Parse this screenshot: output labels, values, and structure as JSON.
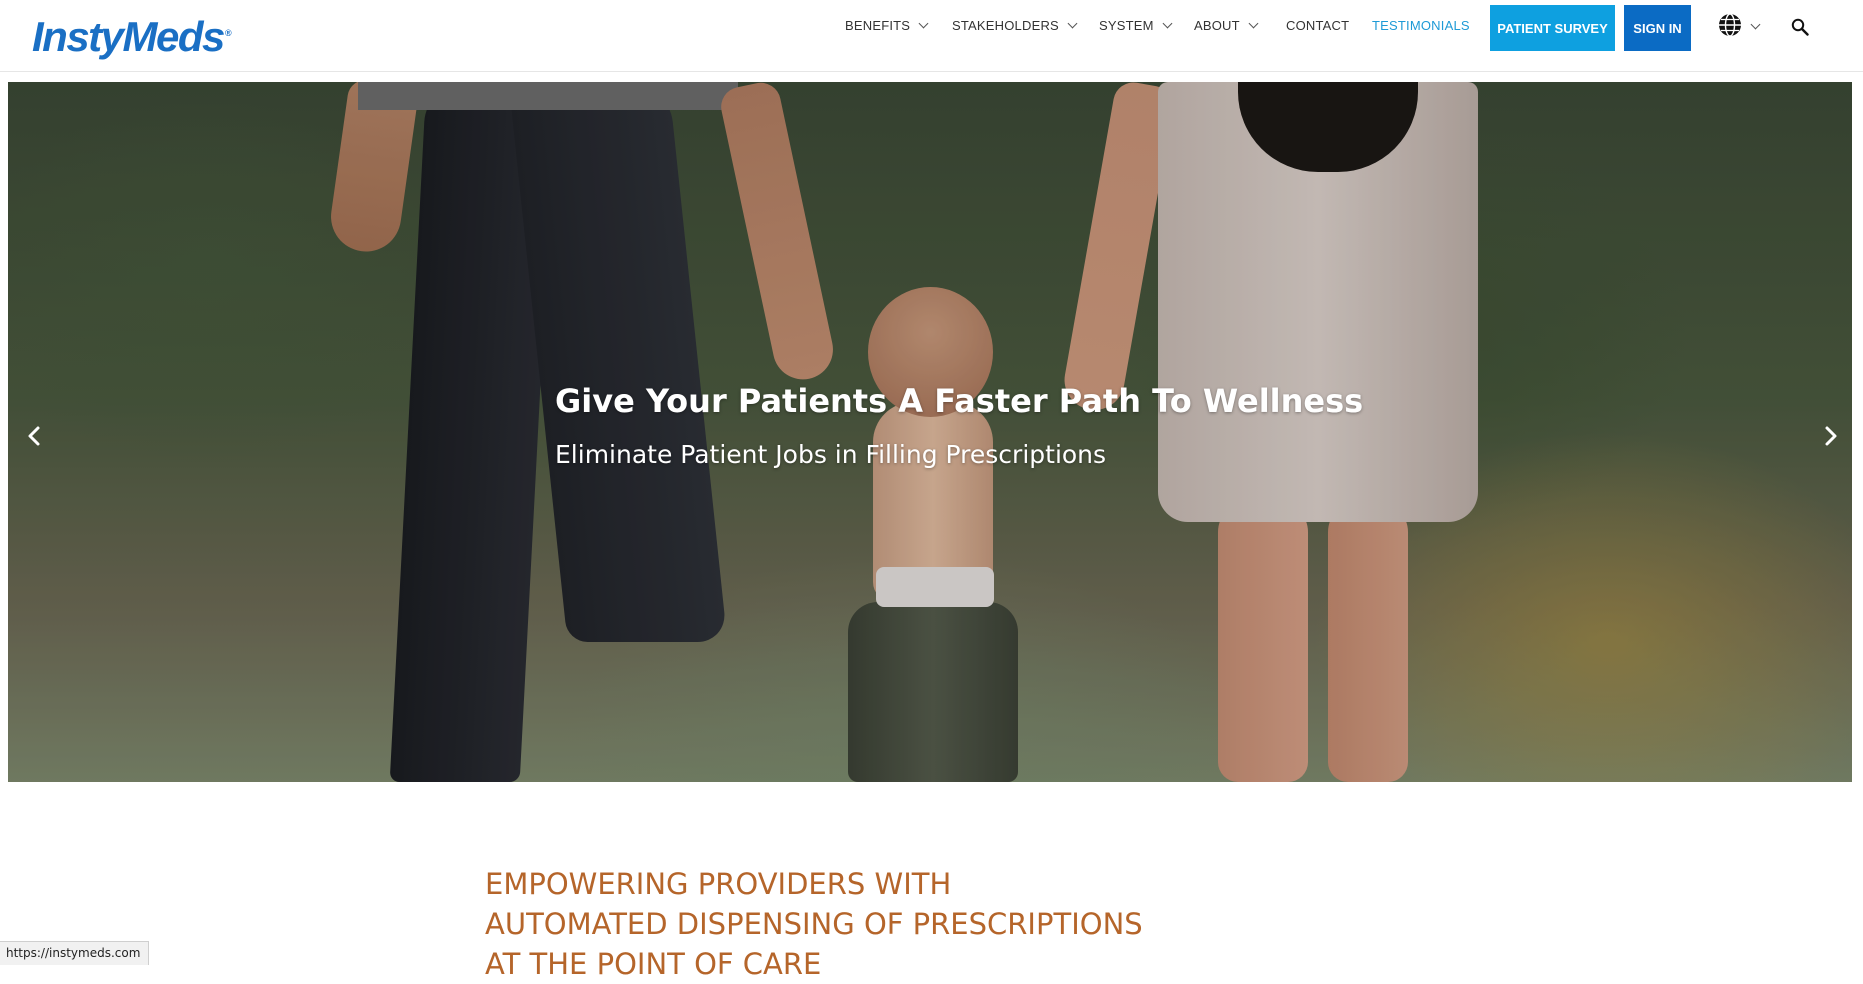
{
  "brand": {
    "name": "InstyMeds",
    "color": "#1a6fc4"
  },
  "nav": {
    "items": [
      {
        "label": "BENEFITS",
        "has_dropdown": true
      },
      {
        "label": "STAKEHOLDERS",
        "has_dropdown": true
      },
      {
        "label": "SYSTEM",
        "has_dropdown": true
      },
      {
        "label": "ABOUT",
        "has_dropdown": true
      },
      {
        "label": "CONTACT",
        "has_dropdown": false
      },
      {
        "label": "TESTIMONIALS",
        "has_dropdown": false,
        "active": true
      }
    ],
    "patient_survey_label": "PATIENT SURVEY",
    "sign_in_label": "SIGN IN",
    "language_icon": "globe-icon",
    "search_icon": "search-icon",
    "active_color": "#1e9ad6",
    "survey_color": "#0ea0e0",
    "signin_color": "#0b6bc4"
  },
  "hero": {
    "title": "Give Your Patients A Faster Path To Wellness",
    "subtitle": "Eliminate Patient Jobs in Filling Prescriptions",
    "prev_icon": "chevron-left-icon",
    "next_icon": "chevron-right-icon"
  },
  "section": {
    "heading_lines": [
      "EMPOWERING PROVIDERS WITH",
      "AUTOMATED DISPENSING OF PRESCRIPTIONS",
      "AT THE POINT OF CARE"
    ],
    "heading_color": "#b5652a"
  },
  "status_bar": {
    "url": "https://instymeds.com"
  }
}
